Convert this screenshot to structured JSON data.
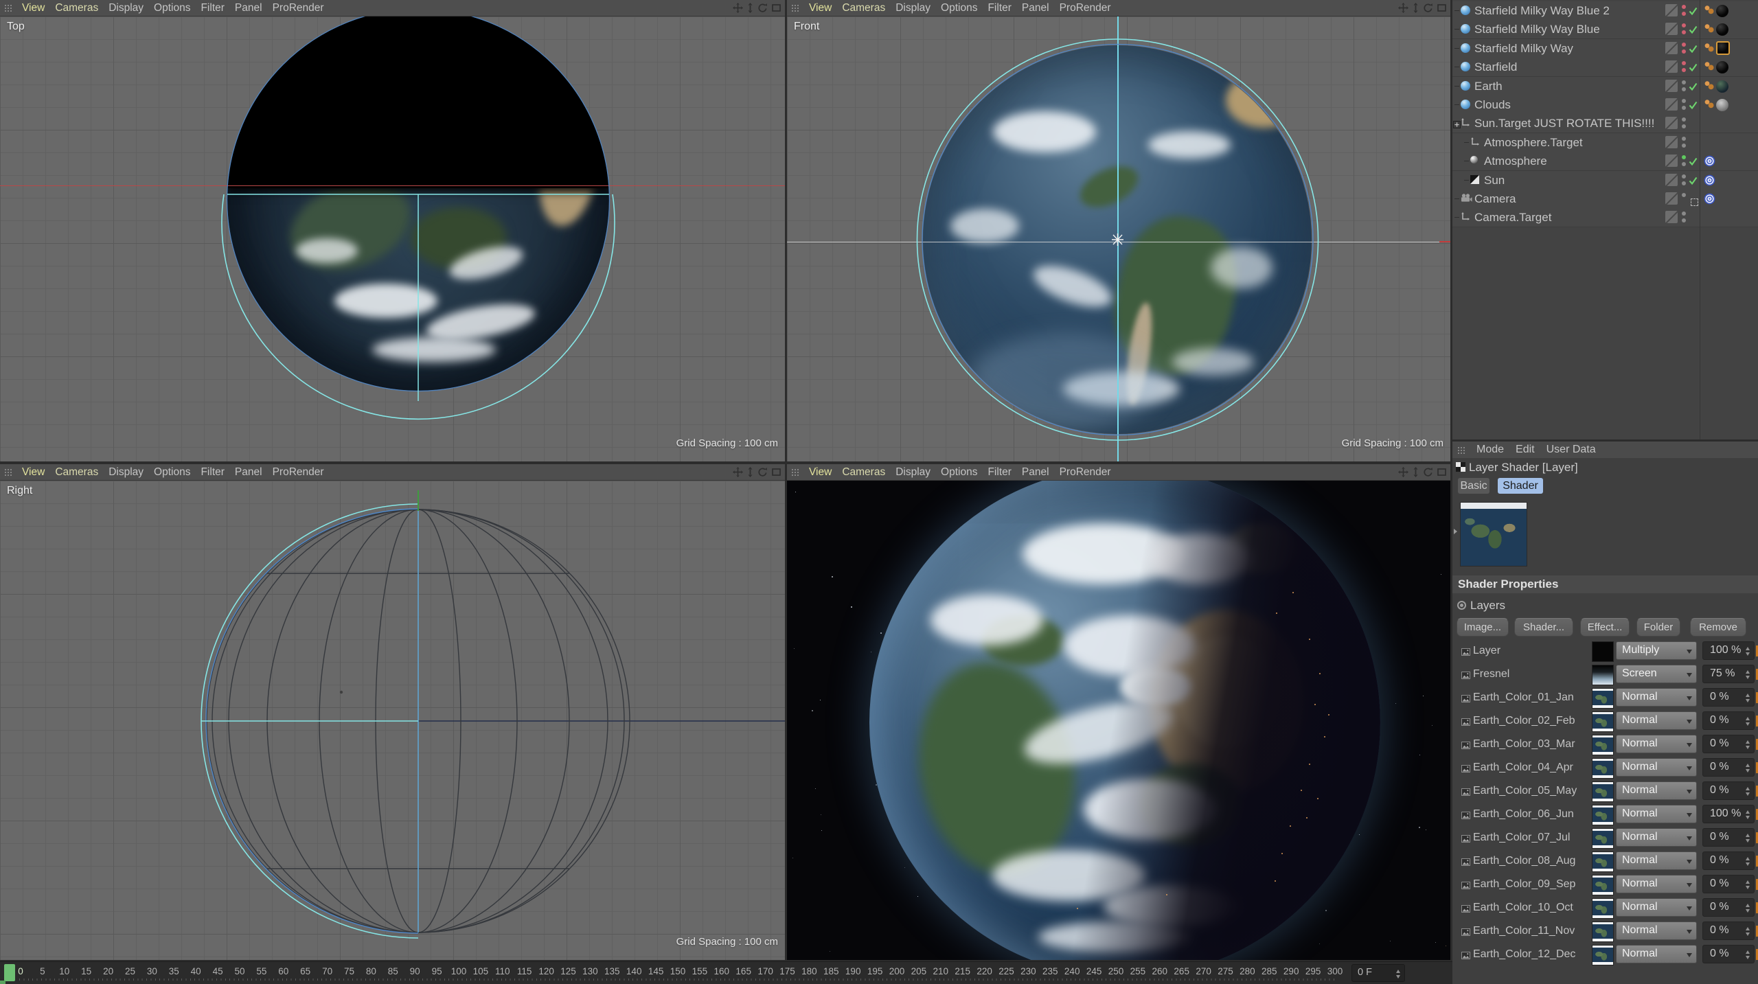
{
  "viewport_menu": {
    "items": [
      "View",
      "Cameras",
      "Display",
      "Options",
      "Filter",
      "Panel",
      "ProRender"
    ]
  },
  "viewport_nav_icons": [
    "pan-icon",
    "zoom-icon",
    "rotate-icon",
    "maximize-icon"
  ],
  "viewports": {
    "top": {
      "label": "Top",
      "grid_spacing": "Grid Spacing : 100 cm"
    },
    "front": {
      "label": "Front",
      "grid_spacing": "Grid Spacing : 100 cm"
    },
    "right": {
      "label": "Right",
      "grid_spacing": "Grid Spacing : 100 cm"
    },
    "perspective": {
      "label": ""
    }
  },
  "object_manager": {
    "objects": [
      {
        "name": "Starfield Milky Way Blue 2",
        "icon": "sphere",
        "depth": 0,
        "visibility_dots": "red",
        "enabled_check": true,
        "tags": [
          "phong",
          "material-black"
        ]
      },
      {
        "name": "Starfield Milky Way Blue",
        "icon": "sphere",
        "depth": 0,
        "visibility_dots": "red",
        "enabled_check": true,
        "tags": [
          "phong",
          "material-black"
        ]
      },
      {
        "name": "Starfield Milky Way",
        "icon": "sphere",
        "depth": 0,
        "visibility_dots": "red",
        "enabled_check": true,
        "tags": [
          "phong",
          "material-black-selected"
        ]
      },
      {
        "name": "Starfield",
        "icon": "sphere",
        "depth": 0,
        "visibility_dots": "red",
        "enabled_check": true,
        "tags": [
          "phong",
          "material-black"
        ]
      },
      {
        "name": "Earth",
        "icon": "sphere",
        "depth": 0,
        "visibility_dots": "gray",
        "enabled_check": true,
        "tags": [
          "phong",
          "material-earth"
        ]
      },
      {
        "name": "Clouds",
        "icon": "sphere",
        "depth": 0,
        "visibility_dots": "gray",
        "enabled_check": true,
        "tags": [
          "phong",
          "material-clouds"
        ]
      },
      {
        "name": "Sun.Target JUST ROTATE THIS!!!!",
        "icon": "null",
        "depth": 0,
        "expanded": true,
        "visibility_dots": "gray",
        "enabled_check": false,
        "tags": []
      },
      {
        "name": "Atmosphere.Target",
        "icon": "null",
        "depth": 1,
        "visibility_dots": "gray",
        "enabled_check": false,
        "tags": []
      },
      {
        "name": "Atmosphere",
        "icon": "sphere-small",
        "depth": 1,
        "visibility_dots": "green",
        "enabled_check": true,
        "tags": [
          "target"
        ]
      },
      {
        "name": "Sun",
        "icon": "light",
        "depth": 1,
        "visibility_dots": "gray",
        "enabled_check": true,
        "tags": [
          "target"
        ]
      },
      {
        "name": "Camera",
        "icon": "camera",
        "depth": 0,
        "visibility_dots": "camera",
        "enabled_check": false,
        "tags": [
          "target"
        ]
      },
      {
        "name": "Camera.Target",
        "icon": "null",
        "depth": 0,
        "visibility_dots": "gray",
        "enabled_check": false,
        "tags": []
      }
    ]
  },
  "attribute_manager": {
    "menu": [
      "Mode",
      "Edit",
      "User Data"
    ],
    "title": "Layer Shader [Layer]",
    "tabs": [
      "Basic",
      "Shader"
    ],
    "active_tab": "Shader",
    "section_header": "Shader Properties",
    "layers_label": "Layers",
    "buttons": [
      "Image...",
      "Shader...",
      "Effect...",
      "Folder",
      "Remove"
    ],
    "layers": [
      {
        "name": "Layer",
        "blend": "Multiply",
        "opacity": "100 %",
        "thumb": "black"
      },
      {
        "name": "Fresnel",
        "blend": "Screen",
        "opacity": "75 %",
        "thumb": "fresnel"
      },
      {
        "name": "Earth_Color_01_Jan",
        "blend": "Normal",
        "opacity": "0 %",
        "thumb": "earth"
      },
      {
        "name": "Earth_Color_02_Feb",
        "blend": "Normal",
        "opacity": "0 %",
        "thumb": "earth"
      },
      {
        "name": "Earth_Color_03_Mar",
        "blend": "Normal",
        "opacity": "0 %",
        "thumb": "earth"
      },
      {
        "name": "Earth_Color_04_Apr",
        "blend": "Normal",
        "opacity": "0 %",
        "thumb": "earth"
      },
      {
        "name": "Earth_Color_05_May",
        "blend": "Normal",
        "opacity": "0 %",
        "thumb": "earth"
      },
      {
        "name": "Earth_Color_06_Jun",
        "blend": "Normal",
        "opacity": "100 %",
        "thumb": "earth"
      },
      {
        "name": "Earth_Color_07_Jul",
        "blend": "Normal",
        "opacity": "0 %",
        "thumb": "earth"
      },
      {
        "name": "Earth_Color_08_Aug",
        "blend": "Normal",
        "opacity": "0 %",
        "thumb": "earth"
      },
      {
        "name": "Earth_Color_09_Sep",
        "blend": "Normal",
        "opacity": "0 %",
        "thumb": "earth"
      },
      {
        "name": "Earth_Color_10_Oct",
        "blend": "Normal",
        "opacity": "0 %",
        "thumb": "earth"
      },
      {
        "name": "Earth_Color_11_Nov",
        "blend": "Normal",
        "opacity": "0 %",
        "thumb": "earth"
      },
      {
        "name": "Earth_Color_12_Dec",
        "blend": "Normal",
        "opacity": "0 %",
        "thumb": "earth"
      }
    ]
  },
  "timeline": {
    "tick_labels": [
      "0",
      "5",
      "10",
      "15",
      "20",
      "25",
      "30",
      "35",
      "40",
      "45",
      "50",
      "55",
      "60",
      "65",
      "70",
      "75",
      "80",
      "85",
      "90",
      "95",
      "100",
      "105",
      "110",
      "115",
      "120",
      "125",
      "130",
      "135",
      "140",
      "145",
      "150",
      "155",
      "160",
      "165",
      "170",
      "175",
      "180",
      "185",
      "190",
      "195",
      "200",
      "205",
      "210",
      "215",
      "220",
      "225",
      "230",
      "235",
      "240",
      "245",
      "250",
      "255",
      "260",
      "265",
      "270",
      "275",
      "280",
      "285",
      "290",
      "295",
      "300"
    ],
    "frame_field": "0 F"
  },
  "colors": {
    "selection_cyan": "#7fe0e8",
    "sphere_edge_blue": "#4f86c6",
    "axis_red": "#c23c3c",
    "axis_green": "#3f9b3f",
    "tab_active_blue": "#a3c0e8",
    "phong_orange": "#d0893c",
    "keyframe_orange": "#c8781e",
    "playhead_green": "#6dbf72"
  }
}
